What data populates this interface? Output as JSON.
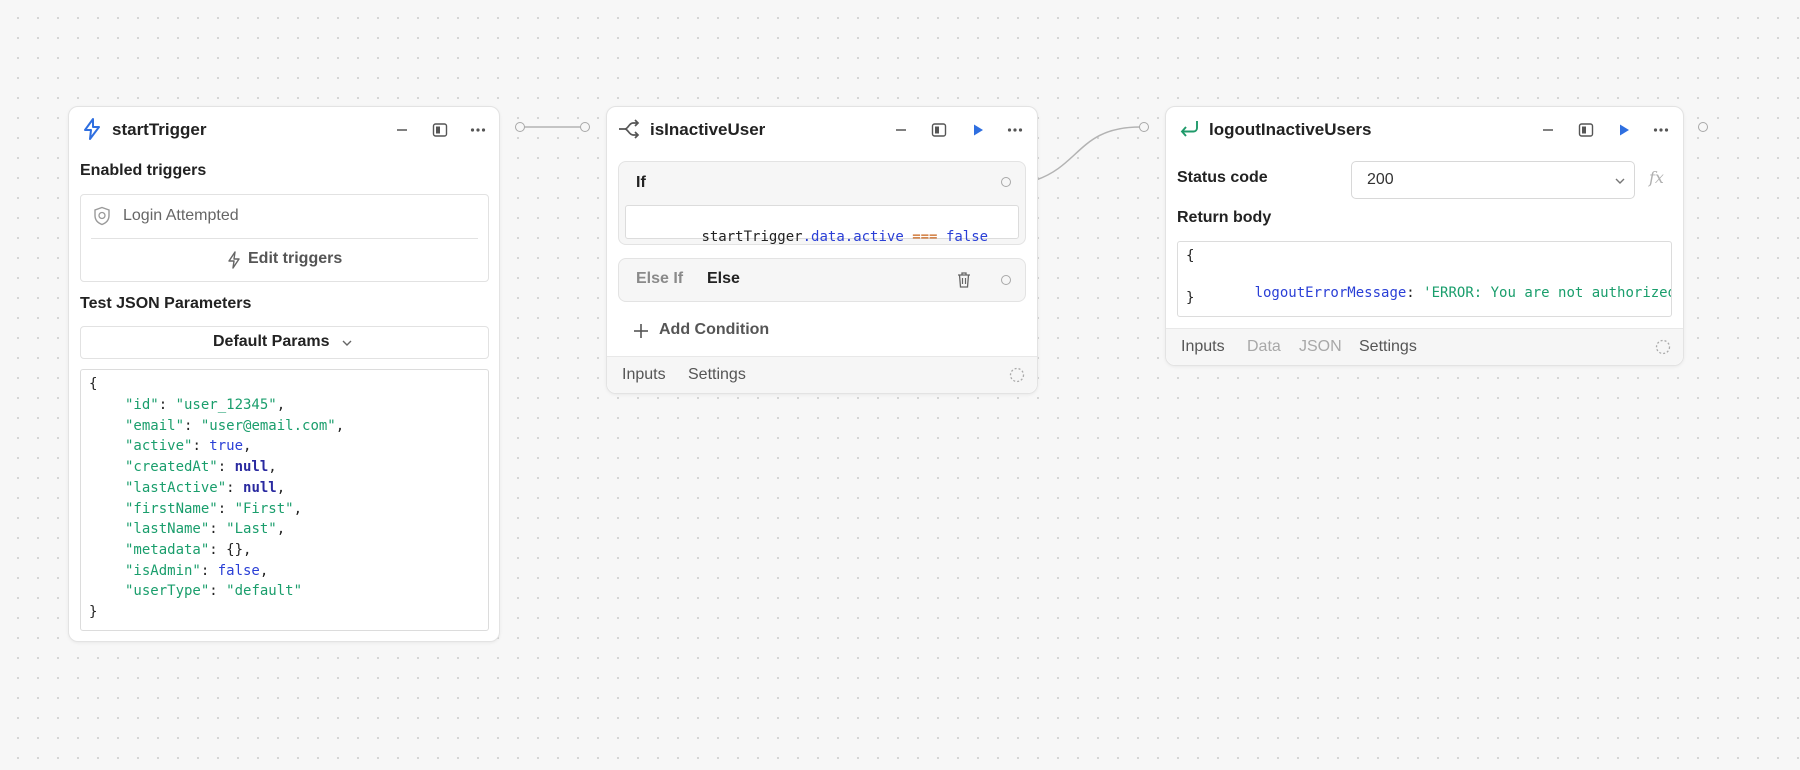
{
  "nodes": {
    "start": {
      "title": "startTrigger",
      "icon": "lightning-icon",
      "enabled_label": "Enabled triggers",
      "trigger_item": "Login Attempted",
      "edit_triggers": "Edit triggers",
      "test_label": "Test JSON Parameters",
      "params_select": "Default Params",
      "json_open": "{",
      "json_close": "}",
      "json_rows": [
        {
          "key": "\"id\"",
          "value": "\"user_12345\"",
          "type": "string",
          "comma": ","
        },
        {
          "key": "\"email\"",
          "value": "\"user@email.com\"",
          "type": "string",
          "comma": ","
        },
        {
          "key": "\"active\"",
          "value": "true",
          "type": "bool",
          "comma": ","
        },
        {
          "key": "\"createdAt\"",
          "value": "null",
          "type": "null",
          "comma": ","
        },
        {
          "key": "\"lastActive\"",
          "value": "null",
          "type": "null",
          "comma": ","
        },
        {
          "key": "\"firstName\"",
          "value": "\"First\"",
          "type": "string",
          "comma": ","
        },
        {
          "key": "\"lastName\"",
          "value": "\"Last\"",
          "type": "string",
          "comma": ","
        },
        {
          "key": "\"metadata\"",
          "value": "{}",
          "type": "plain",
          "comma": ","
        },
        {
          "key": "\"isAdmin\"",
          "value": "false",
          "type": "bool",
          "comma": ","
        },
        {
          "key": "\"userType\"",
          "value": "\"default\"",
          "type": "string",
          "comma": ""
        }
      ]
    },
    "branch": {
      "title": "isInactiveUser",
      "icon": "branch-icon",
      "if_label": "If",
      "expr": {
        "obj": "startTrigger",
        "dot1": ".",
        "prop1": "data",
        "dot2": ".",
        "prop2": "active",
        "op": "===",
        "val": "false"
      },
      "elseif_label": "Else If",
      "else_label": "Else",
      "add_condition": "Add Condition",
      "footer_tabs": [
        "Inputs",
        "Settings"
      ]
    },
    "logout": {
      "title": "logoutInactiveUsers",
      "icon": "return-icon",
      "status_label": "Status code",
      "status_value": "200",
      "fx": "fx",
      "body_label": "Return body",
      "body_open": "{",
      "body_key": "logoutErrorMessage",
      "body_colon": ":",
      "body_value": "'ERROR: You are not authorized.'",
      "body_close": "}",
      "footer_tabs": [
        "Inputs",
        "Data",
        "JSON",
        "Settings"
      ]
    }
  },
  "colors": {
    "accent_blue": "#2f6fe0",
    "string_green": "#1a9e6c",
    "keyword_blue": "#2a3fd6",
    "operator_orange": "#c8631a",
    "return_green": "#1f9a6a"
  }
}
